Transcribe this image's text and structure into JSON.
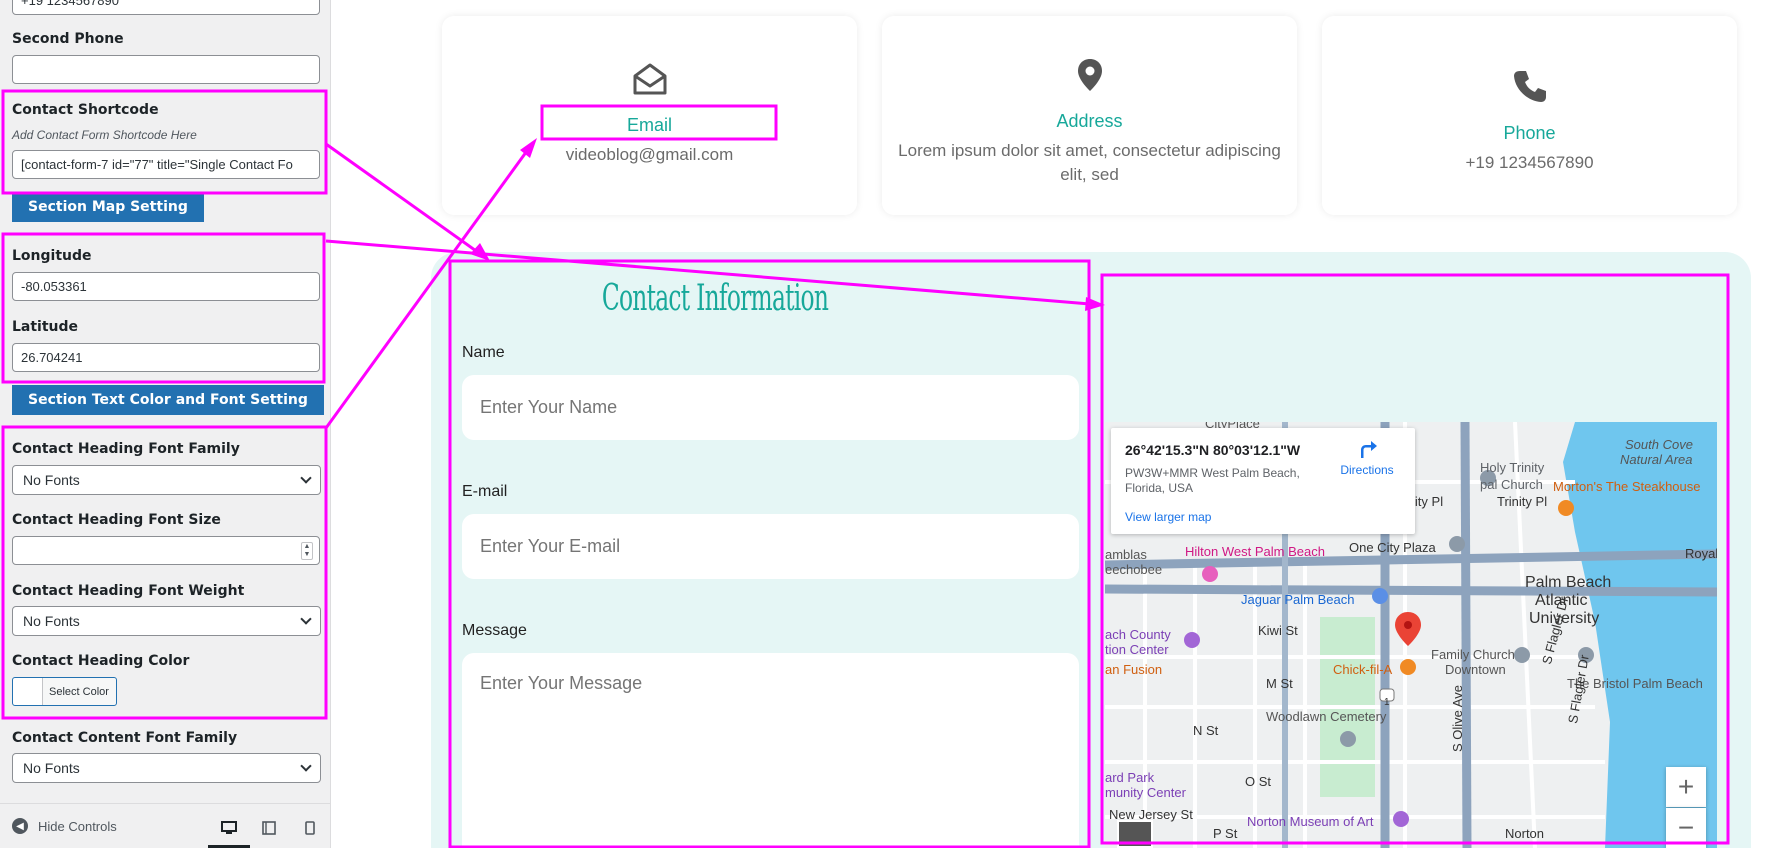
{
  "panel": {
    "top_phone_value": "+19 1234567890",
    "second_phone_label": "Second Phone",
    "second_phone_value": "",
    "shortcode_label": "Contact Shortcode",
    "shortcode_desc": "Add Contact Form Shortcode Here",
    "shortcode_value": "[contact-form-7 id=\"77\" title=\"Single Contact Fo",
    "map_section_button": "Section Map Setting",
    "longitude_label": "Longitude",
    "longitude_value": "-80.053361",
    "latitude_label": "Latitude",
    "latitude_value": "26.704241",
    "text_color_button": "Section Text Color and Font Setting",
    "heading_font_family_label": "Contact Heading Font Family",
    "heading_font_family_value": "No Fonts",
    "heading_font_size_label": "Contact Heading Font Size",
    "heading_font_size_value": "",
    "heading_font_weight_label": "Contact Heading Font Weight",
    "heading_font_weight_value": "No Fonts",
    "heading_color_label": "Contact Heading Color",
    "select_color_label": "Select Color",
    "content_font_family_label": "Contact Content Font Family",
    "content_font_family_value": "No Fonts",
    "hide_controls": "Hide Controls"
  },
  "cards": {
    "email": {
      "title": "Email",
      "value": "videoblog@gmail.com",
      "icon": "envelope-open-icon"
    },
    "address": {
      "title": "Address",
      "value": "Lorem ipsum dolor sit amet, consectetur adipiscing elit, sed",
      "icon": "map-pin-icon"
    },
    "phone": {
      "title": "Phone",
      "value": "+19 1234567890",
      "icon": "phone-icon"
    }
  },
  "form": {
    "heading": "Contact Information",
    "name_label": "Name",
    "name_placeholder": "Enter Your Name",
    "email_label": "E-mail",
    "email_placeholder": "Enter Your E-mail",
    "message_label": "Message",
    "message_placeholder": "Enter Your Message"
  },
  "map": {
    "coords": "26°42'15.3\"N 80°03'12.1\"W",
    "address": "PW3W+MMR West Palm Beach, Florida, USA",
    "directions": "Directions",
    "view_larger": "View larger map",
    "labels": {
      "holy_trinity": "Holy Trinity",
      "episcopal_church": "pal Church",
      "trinity_pl": "Trinity Pl",
      "trinity_pl2": "Trinity Pl",
      "south_cove": "South Cove",
      "natural_area": "Natural Area",
      "mortons": "Morton's The Steakhouse",
      "hilton": "Hilton West Palm Beach",
      "one_city_plaza": "One City Plaza",
      "royal": "Royal",
      "ramblas": "amblas",
      "okeechobee": "eechobee",
      "jaguar": "Jaguar Palm Beach",
      "palm_beach": "Palm Beach",
      "atlantic": "Atlantic",
      "university": "University",
      "kiwi_st": "Kiwi St",
      "beach_county": "ach County",
      "tion_center": "tion Center",
      "family_church": "Family Church",
      "downtown": "Downtown",
      "chick_fil_a": "Chick-fil-A",
      "bristol": "The Bristol Palm Beach",
      "an_fusion": "an Fusion",
      "m_st": "M St",
      "woodlawn": "Woodlawn Cemetery",
      "n_st": "N St",
      "ard_park": "ard Park",
      "munity_center": "munity Center",
      "o_st": "O St",
      "new_jersey": "New Jersey St",
      "norton_museum": "Norton Museum of Art",
      "p_st": "P St",
      "norton": "Norton",
      "s_olive": "S Olive Ave",
      "s_flagler": "S Flagler Dr",
      "s_flagler2": "S Flagler Dr",
      "city_place": "CityPlace",
      "route_1": "1"
    },
    "zoom_in": "+",
    "zoom_out": "−"
  },
  "colors": {
    "accent": "#17a89a",
    "annotation": "#ff00ff",
    "wp_button": "#2271b1"
  }
}
